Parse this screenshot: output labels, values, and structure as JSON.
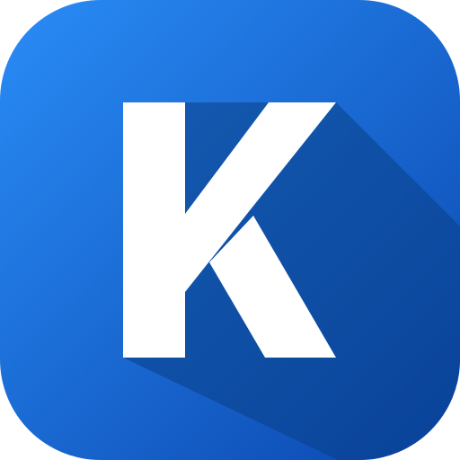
{
  "icon": {
    "name": "k-letter-app-icon",
    "letter": "K",
    "colors": {
      "gradient_start": "#2a8cf6",
      "gradient_end": "#0a46ae",
      "shadow": "#0a3f86",
      "letter": "#ffffff"
    }
  }
}
